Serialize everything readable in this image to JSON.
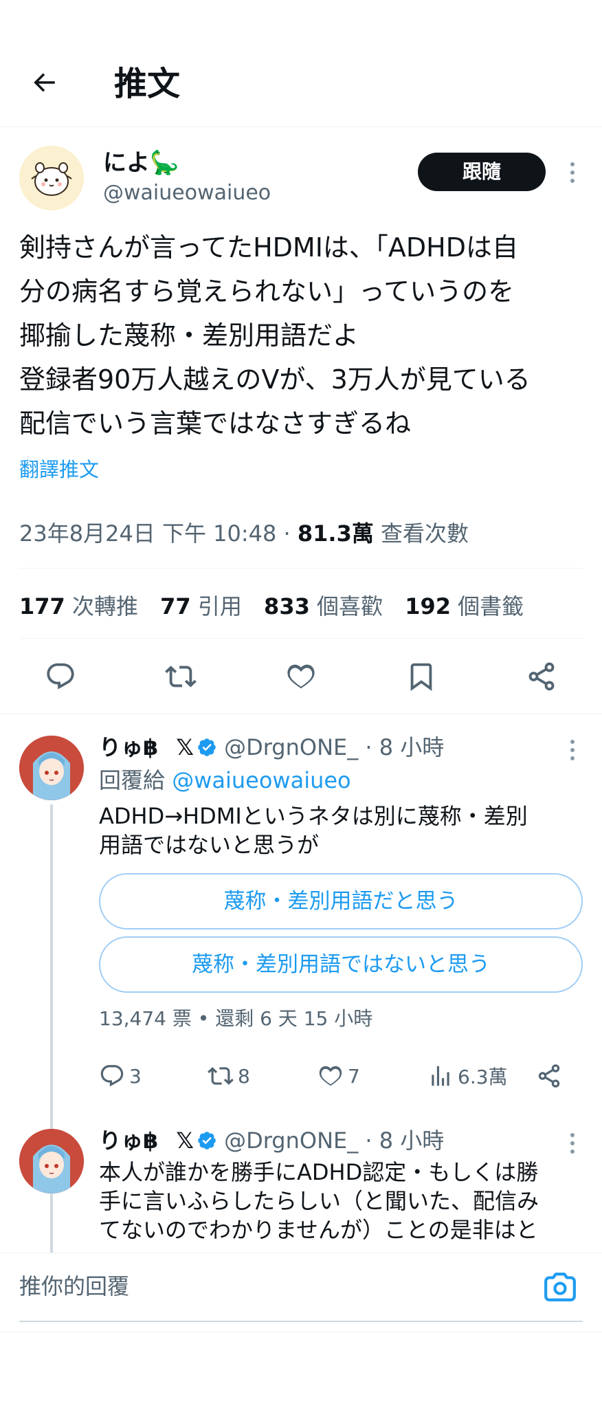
{
  "header": {
    "title": "推文"
  },
  "tweet": {
    "display_name": "によ🦕",
    "handle": "@waiueowaiueo",
    "follow_label": "跟隨",
    "lines": [
      "剣持さんが言ってたHDMIは、「ADHDは自",
      "分の病名すら覚えられない」っていうのを",
      "揶揄した蔑称・差別用語だよ",
      "登録者90万人越えのVが、3万人が見ている",
      "配信でいう言葉ではなさすぎるね"
    ],
    "translate_label": "翻譯推文",
    "timestamp": "23年8月24日 下午 10:48 · ",
    "views_count": "81.3萬",
    "views_label": " 查看次數",
    "stats": {
      "retweets_count": "177",
      "retweets_label": " 次轉推",
      "quotes_count": "77",
      "quotes_label": " 引用",
      "likes_count": "833",
      "likes_label": " 個喜歡",
      "bookmarks_count": "192",
      "bookmarks_label": " 個書籤"
    }
  },
  "replies": [
    {
      "display_name": "りゅ฿",
      "x_logo": "𝕏",
      "handle": "@DrgnONE_",
      "time": " · 8 小時",
      "replying_prefix": "回覆給 ",
      "replying_handle": "@waiueowaiueo",
      "lines": [
        "ADHD→HDMIというネタは別に蔑称・差別",
        "用語ではないと思うが"
      ],
      "poll": {
        "options": [
          "蔑称・差別用語だと思う",
          "蔑称・差別用語ではないと思う"
        ],
        "meta": "13,474 票 • 還剩 6 天 15 小時"
      },
      "actions": {
        "replies": "3",
        "retweets": "8",
        "likes": "7",
        "views": "6.3萬"
      }
    },
    {
      "display_name": "りゅ฿",
      "x_logo": "𝕏",
      "handle": "@DrgnONE_",
      "time": " · 8 小時",
      "lines": [
        "本人が誰かを勝手にADHD認定・もしくは勝",
        "手に言いふらしたらしい（と聞いた、配信み",
        "てないのでわかりませんが）ことの是非はと"
      ]
    }
  ],
  "compose": {
    "placeholder": "推你的回覆"
  },
  "colors": {
    "accent": "#1d9bf0",
    "text": "#0f1419",
    "secondary": "#536471",
    "follow_bg": "#0f1419"
  },
  "icons": [
    "back-arrow-icon",
    "more-icon",
    "reply-icon",
    "retweet-icon",
    "like-icon",
    "bookmark-icon",
    "share-icon",
    "verified-icon",
    "views-icon",
    "camera-icon"
  ]
}
